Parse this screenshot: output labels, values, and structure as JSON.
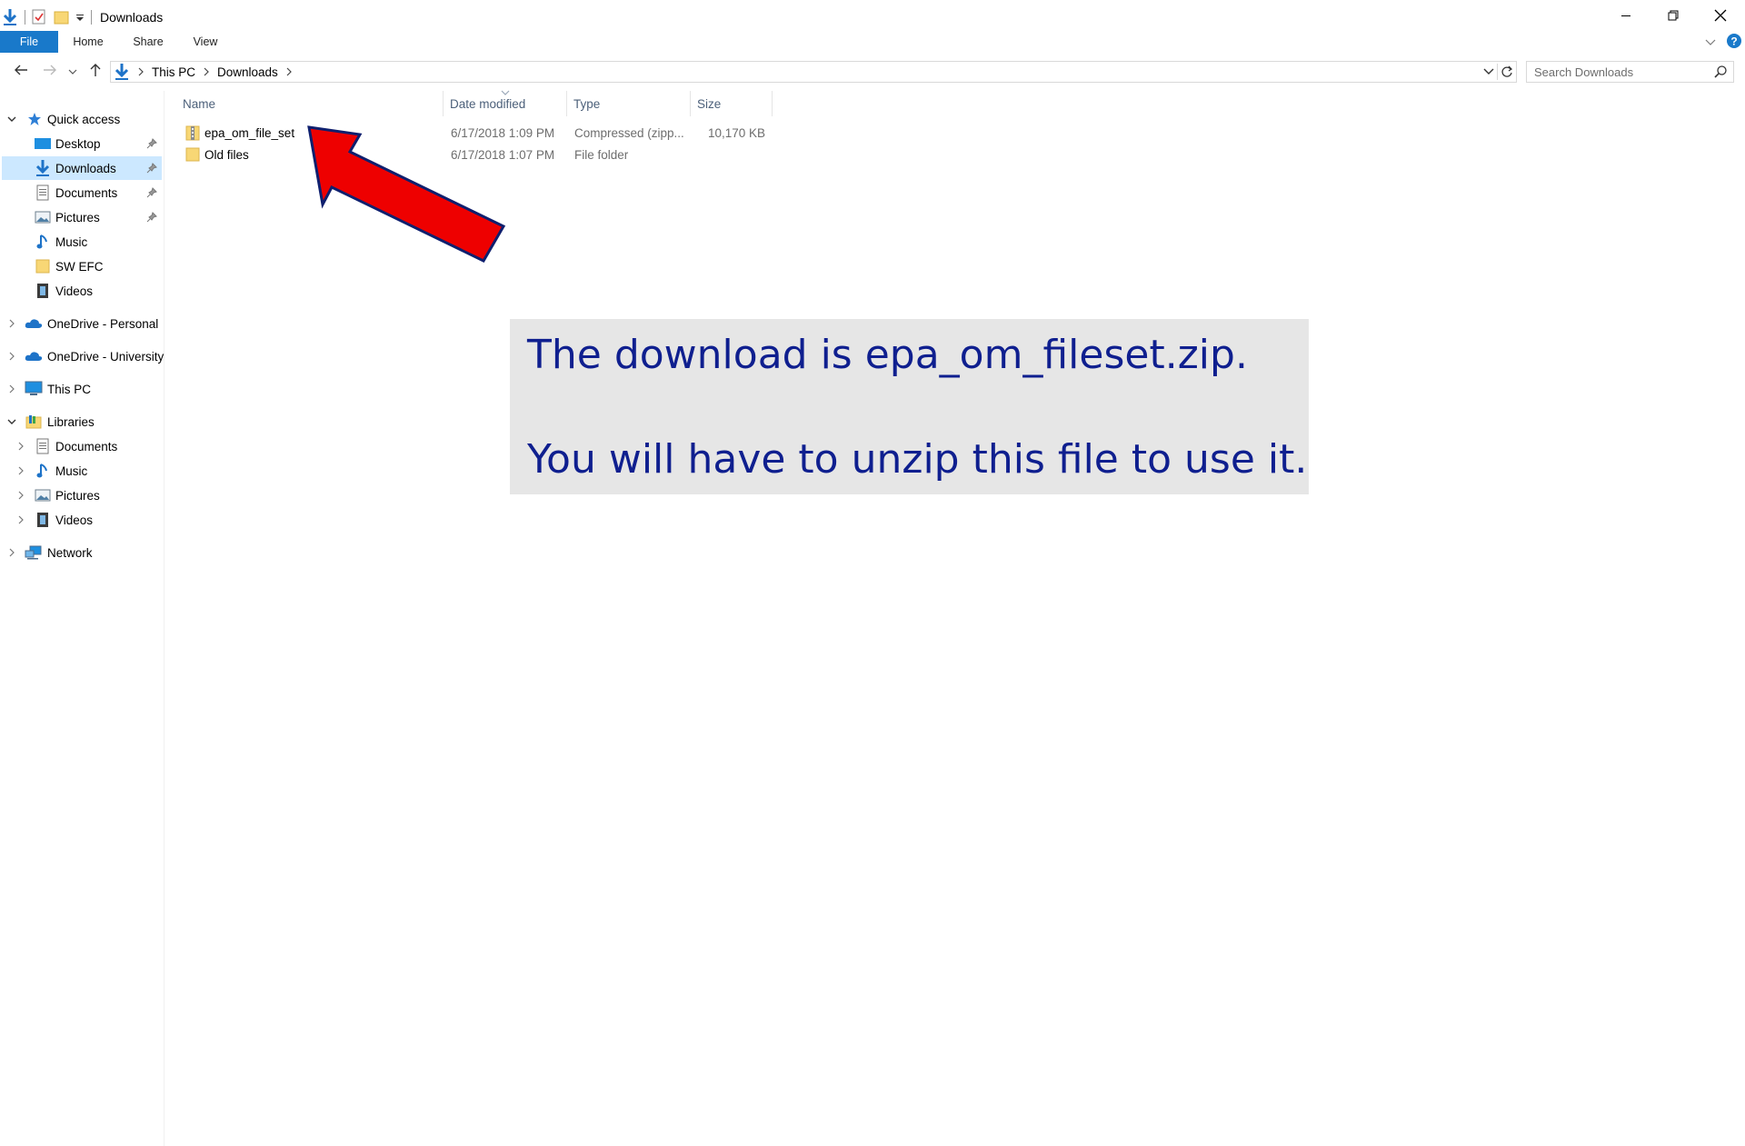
{
  "window": {
    "title": "Downloads",
    "minimize_icon": "minimize-icon",
    "restore_icon": "restore-icon",
    "close_icon": "close-icon"
  },
  "ribbon": {
    "tabs": [
      "File",
      "Home",
      "Share",
      "View"
    ]
  },
  "address": {
    "crumbs": [
      "This PC",
      "Downloads"
    ]
  },
  "search": {
    "placeholder": "Search Downloads"
  },
  "sidebar": {
    "quick_access": {
      "label": "Quick access",
      "items": [
        {
          "label": "Desktop",
          "icon": "desktop-icon",
          "pinned": true
        },
        {
          "label": "Downloads",
          "icon": "download-arrow-icon",
          "pinned": true,
          "selected": true
        },
        {
          "label": "Documents",
          "icon": "document-icon",
          "pinned": true
        },
        {
          "label": "Pictures",
          "icon": "pictures-icon",
          "pinned": true
        },
        {
          "label": "Music",
          "icon": "music-note-icon",
          "pinned": false
        },
        {
          "label": "SW EFC",
          "icon": "folder-icon",
          "pinned": false
        },
        {
          "label": "Videos",
          "icon": "film-icon",
          "pinned": false
        }
      ]
    },
    "onedrive_personal": "OneDrive - Personal",
    "onedrive_university": "OneDrive - University",
    "this_pc": "This PC",
    "libraries": {
      "label": "Libraries",
      "items": [
        {
          "label": "Documents",
          "icon": "document-icon"
        },
        {
          "label": "Music",
          "icon": "music-note-icon"
        },
        {
          "label": "Pictures",
          "icon": "pictures-icon"
        },
        {
          "label": "Videos",
          "icon": "film-icon"
        }
      ]
    },
    "network": "Network"
  },
  "file_list": {
    "columns": [
      "Name",
      "Date modified",
      "Type",
      "Size"
    ],
    "rows": [
      {
        "name": "epa_om_file_set",
        "date": "6/17/2018 1:09 PM",
        "type": "Compressed (zipp...",
        "size": "10,170 KB",
        "icon": "zip-folder-icon"
      },
      {
        "name": "Old files",
        "date": "6/17/2018 1:07 PM",
        "type": "File folder",
        "size": "",
        "icon": "folder-icon"
      }
    ]
  },
  "callout": {
    "line1": "The download is epa_om_fileset.zip.",
    "line2": "You will have to unzip this file to use it."
  },
  "colors": {
    "accent": "#1979ca",
    "selected_bg": "#cce8ff",
    "callout_bg": "#e6e6e6",
    "callout_text": "#0f1f8f",
    "arrow_fill": "#ee0000",
    "arrow_stroke": "#0f1f6e"
  }
}
